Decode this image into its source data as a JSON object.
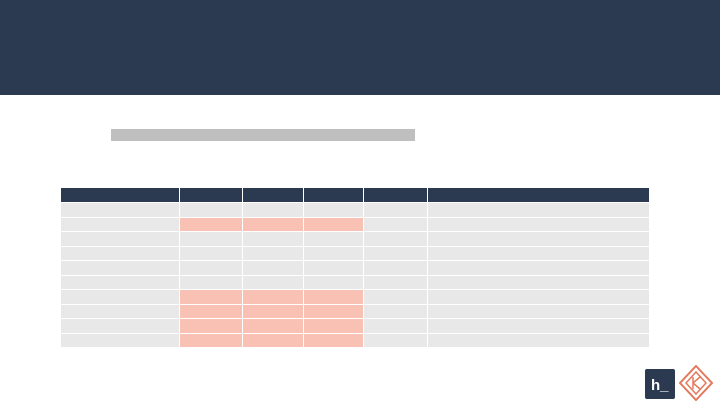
{
  "slide": {
    "table": {
      "header": [
        "",
        "",
        "",
        "",
        "",
        ""
      ],
      "rows": [
        {
          "cells": [
            "",
            "",
            "",
            "",
            "",
            ""
          ],
          "highlight": [
            false,
            false,
            false,
            false,
            false,
            false
          ]
        },
        {
          "cells": [
            "",
            "",
            "",
            "",
            "",
            ""
          ],
          "highlight": [
            false,
            true,
            true,
            true,
            false,
            false
          ]
        },
        {
          "cells": [
            "",
            "",
            "",
            "",
            "",
            ""
          ],
          "highlight": [
            false,
            false,
            false,
            false,
            false,
            false
          ]
        },
        {
          "cells": [
            "",
            "",
            "",
            "",
            "",
            ""
          ],
          "highlight": [
            false,
            false,
            false,
            false,
            false,
            false
          ]
        },
        {
          "cells": [
            "",
            "",
            "",
            "",
            "",
            ""
          ],
          "highlight": [
            false,
            false,
            false,
            false,
            false,
            false
          ]
        },
        {
          "cells": [
            "",
            "",
            "",
            "",
            "",
            ""
          ],
          "highlight": [
            false,
            false,
            false,
            false,
            false,
            false
          ]
        },
        {
          "cells": [
            "",
            "",
            "",
            "",
            "",
            ""
          ],
          "highlight": [
            false,
            true,
            true,
            true,
            false,
            false
          ]
        },
        {
          "cells": [
            "",
            "",
            "",
            "",
            "",
            ""
          ],
          "highlight": [
            false,
            true,
            true,
            true,
            false,
            false
          ]
        },
        {
          "cells": [
            "",
            "",
            "",
            "",
            "",
            ""
          ],
          "highlight": [
            false,
            true,
            true,
            true,
            false,
            false
          ]
        },
        {
          "cells": [
            "",
            "",
            "",
            "",
            "",
            ""
          ],
          "highlight": [
            false,
            true,
            true,
            true,
            false,
            false
          ]
        }
      ]
    }
  },
  "colors": {
    "header_band": "#2b3a51",
    "row_fill": "#e8e8e8",
    "highlight_fill": "#f8c1b3",
    "logo_accent": "#e4785c"
  },
  "logos": {
    "h_logo_text": "h_",
    "diamond_logo": "diamond-logo-icon"
  }
}
